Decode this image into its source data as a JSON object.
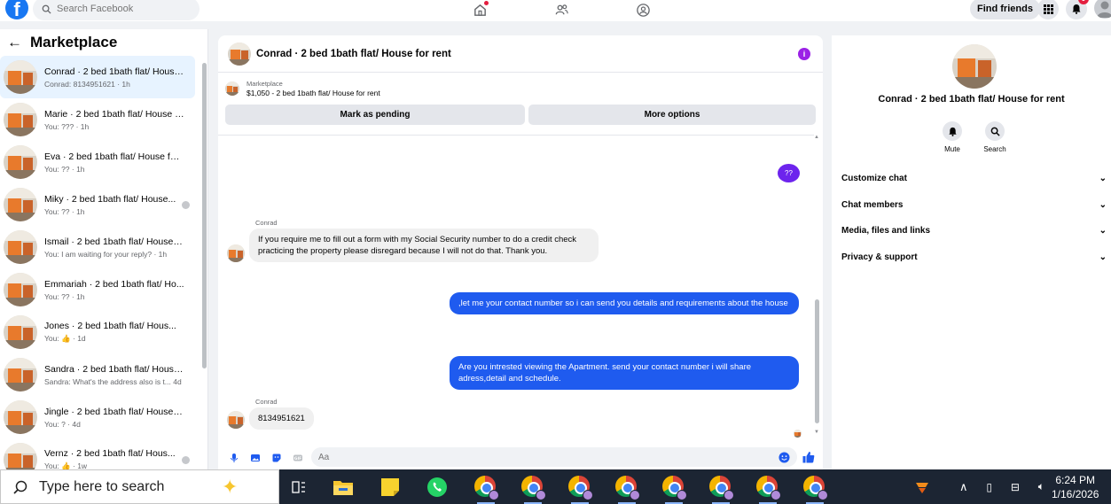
{
  "topbar": {
    "logo": "f",
    "search_placeholder": "Search Facebook",
    "find_friends": "Find friends",
    "notif_count": "9"
  },
  "left": {
    "title": "Marketplace",
    "back": "←",
    "conversations": [
      {
        "title": "Conrad · 2 bed 1bath flat/ House...",
        "sub": "Conrad: 8134951621 · 1h",
        "active": true
      },
      {
        "title": "Marie · 2 bed 1bath flat/ House f...",
        "sub": "You: ??? · 1h"
      },
      {
        "title": "Eva · 2 bed 1bath flat/ House for...",
        "sub": "You: ?? · 1h"
      },
      {
        "title": "Miky · 2 bed 1bath flat/ House...",
        "sub": "You: ?? · 1h"
      },
      {
        "title": "Ismail · 2 bed 1bath flat/ House f...",
        "sub": "You: I am waiting for your reply? · 1h"
      },
      {
        "title": "Emmariah · 2 bed 1bath flat/ Ho...",
        "sub": "You: ?? · 1h"
      },
      {
        "title": "Jones · 2 bed 1bath flat/ Hous...",
        "sub": "You: 👍 · 1d"
      },
      {
        "title": "Sandra · 2 bed 1bath flat/ House...",
        "sub": "Sandra: What's the address also is t... 4d"
      },
      {
        "title": "Jingle · 2 bed 1bath flat/ House f...",
        "sub": "You: ? · 4d"
      },
      {
        "title": "Vernz · 2 bed 1bath flat/ Hous...",
        "sub": "You: 👍 · 1w"
      }
    ]
  },
  "chat": {
    "title": "Conrad · 2 bed 1bath flat/ House for rent",
    "marketplace_label": "Marketplace",
    "listing": "$1,050 - 2 bed 1bath flat/ House for rent",
    "mark_pending": "Mark as pending",
    "more_options": "More options",
    "messages": {
      "m1": "??",
      "sender1": "Conrad",
      "m2": "If you require me to fill out a form with my Social Security number to do a credit check practicing the property please disregard because I will not do that. Thank you.",
      "m3": ",let me your contact number so i can send you details and requirements about the house",
      "m4": "Are you intrested viewing the Apartment. send your contact number i will share adress,detail and schedule.",
      "sender2": "Conrad",
      "m5": "8134951621"
    },
    "composer_placeholder": "Aa"
  },
  "right": {
    "name": "Conrad · 2 bed 1bath flat/ House for rent",
    "mute": "Mute",
    "search": "Search",
    "sections": [
      "Customize chat",
      "Chat members",
      "Media, files and links",
      "Privacy & support"
    ]
  },
  "taskbar": {
    "search_text": "Type here to search",
    "time": "6:24 PM",
    "date": "1/16/2026"
  },
  "colors": {
    "accent_blue": "#1f5bef",
    "accent_purple": "#6d24ed",
    "facebook_blue": "#1877f2"
  }
}
